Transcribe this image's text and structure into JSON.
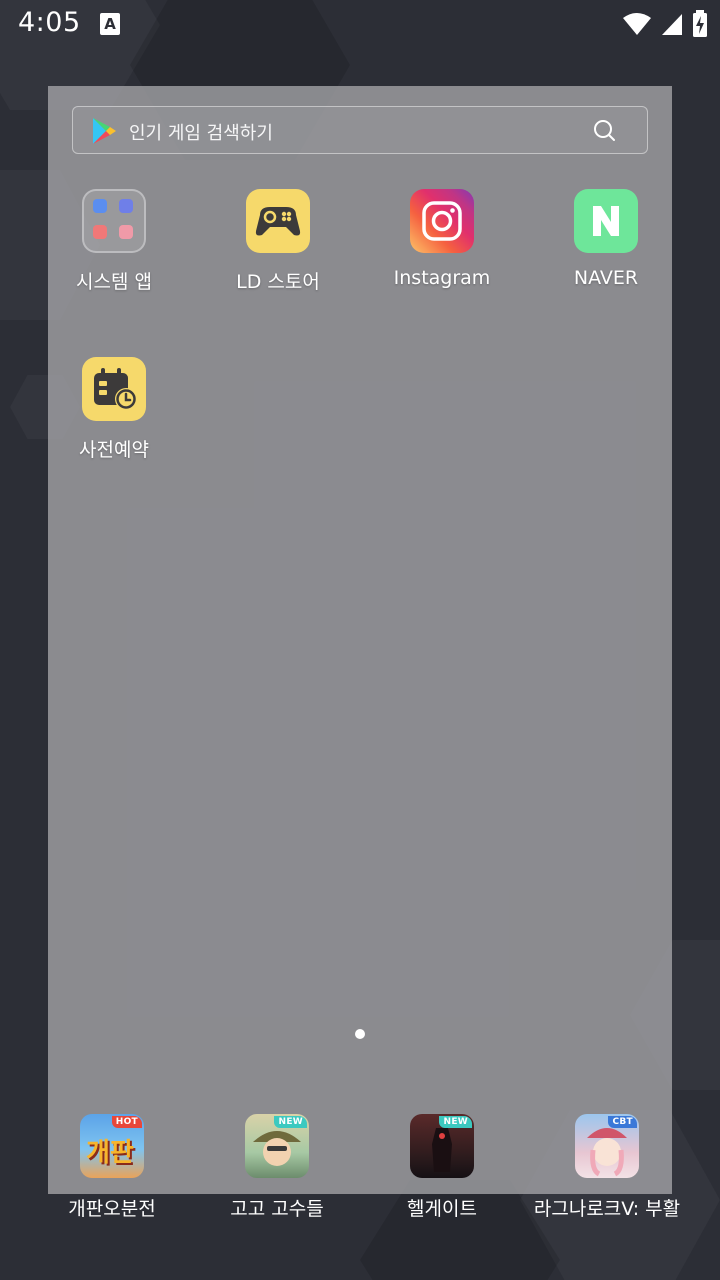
{
  "status_bar": {
    "time": "4:05",
    "notification_icon": "a-box-icon",
    "wifi_icon": "wifi-icon",
    "signal_icon": "cell-signal-icon",
    "battery_icon": "battery-charging-icon"
  },
  "search": {
    "placeholder": "인기 게임 검색하기",
    "icon": "search-icon"
  },
  "apps": [
    {
      "label": "시스템 앱",
      "icon": "folder-icon"
    },
    {
      "label": "LD 스토어",
      "icon": "gamepad-icon",
      "color": "#f6d96b"
    },
    {
      "label": "Instagram",
      "icon": "instagram-icon"
    },
    {
      "label": "NAVER",
      "icon": "naver-icon",
      "color": "#6ee69a"
    },
    {
      "label": "사전예약",
      "icon": "calendar-clock-icon",
      "color": "#f6d96b"
    }
  ],
  "dock": [
    {
      "label": "개판오분전",
      "badge": "HOT",
      "badge_color": "#e8473a",
      "art_text": "개판"
    },
    {
      "label": "고고 고수들",
      "badge": "NEW",
      "badge_color": "#3cc9c0"
    },
    {
      "label": "헬게이트",
      "badge": "NEW",
      "badge_color": "#3cc9c0"
    },
    {
      "label": "라그나로크V: 부활",
      "badge": "CBT",
      "badge_color": "#3a78d8"
    }
  ],
  "colors": {
    "background": "#2c2e36",
    "panel": "#a0a0a4"
  }
}
